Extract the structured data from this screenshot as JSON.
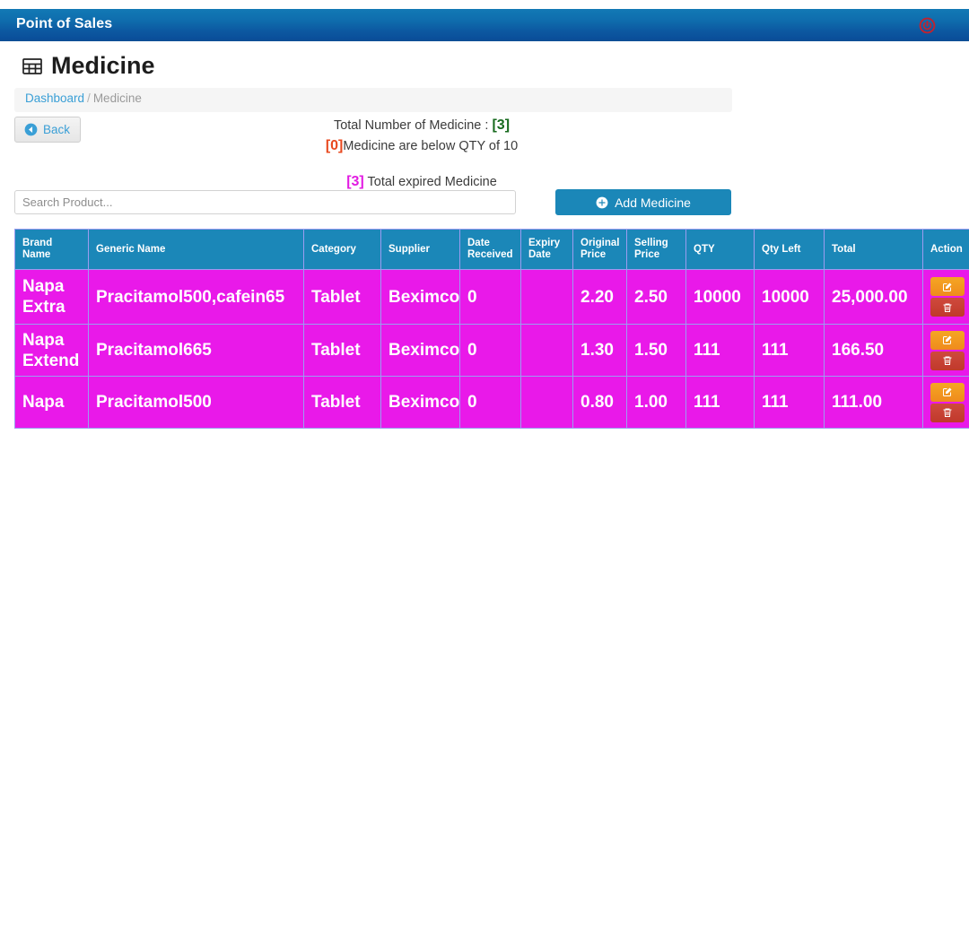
{
  "navbar": {
    "brand": "Point of Sales",
    "power_icon": "power-icon",
    "brand_gradient_top": "#1279b5",
    "brand_gradient_bottom": "#0a4e99",
    "power_color": "#c0232f"
  },
  "page": {
    "title": "Medicine",
    "title_icon": "table-grid-icon"
  },
  "breadcrumb": {
    "home_label": "Dashboard",
    "separator": "/",
    "current_label": "Medicine"
  },
  "toolbar": {
    "back_label": "Back",
    "back_icon": "arrow-circle-left-icon",
    "add_label": "Add Medicine",
    "add_icon": "plus-circle-icon",
    "add_color": "#1b87b8"
  },
  "stats": {
    "total_label_prefix": "Total Number of Medicine : ",
    "total_count": "[3]",
    "total_count_color": "#176a1e",
    "low_count": "[0]",
    "low_count_color": "#e8491f",
    "low_label_suffix": "Medicine are below QTY of 10",
    "expired_count": "[3]",
    "expired_count_color": "#e21ae2",
    "expired_label_suffix": " Total expired Medicine"
  },
  "search": {
    "value": "",
    "placeholder": "Search Product..."
  },
  "table": {
    "header_bg": "#1b87b8",
    "row_bg": "#e919e9",
    "border_color": "#9c9cf0",
    "columns": [
      "Brand Name",
      "Generic Name",
      "Category",
      "Supplier",
      "Date Received",
      "Expiry Date",
      "Original Price",
      "Selling Price",
      "QTY",
      "Qty Left",
      "Total",
      "Action"
    ],
    "rows": [
      {
        "brand_name": "Napa Extra",
        "generic_name": "Pracitamol500,cafein65",
        "category": "Tablet",
        "supplier": "Beximco",
        "date_received": "0",
        "expiry_date": "",
        "original_price": "2.20",
        "selling_price": "2.50",
        "qty": "10000",
        "qty_left": "10000",
        "total": "25,000.00"
      },
      {
        "brand_name": "Napa Extend",
        "generic_name": "Pracitamol665",
        "category": "Tablet",
        "supplier": "Beximco",
        "date_received": "0",
        "expiry_date": "",
        "original_price": "1.30",
        "selling_price": "1.50",
        "qty": "111",
        "qty_left": "111",
        "total": "166.50"
      },
      {
        "brand_name": "Napa",
        "generic_name": "Pracitamol500",
        "category": "Tablet",
        "supplier": "Beximco",
        "date_received": "0",
        "expiry_date": "",
        "original_price": "0.80",
        "selling_price": "1.00",
        "qty": "111",
        "qty_left": "111",
        "total": "111.00"
      }
    ],
    "actions": {
      "edit_icon": "pencil-square-icon",
      "edit_color": "#f5a623",
      "delete_icon": "trash-icon",
      "delete_color": "#c0392b"
    }
  }
}
